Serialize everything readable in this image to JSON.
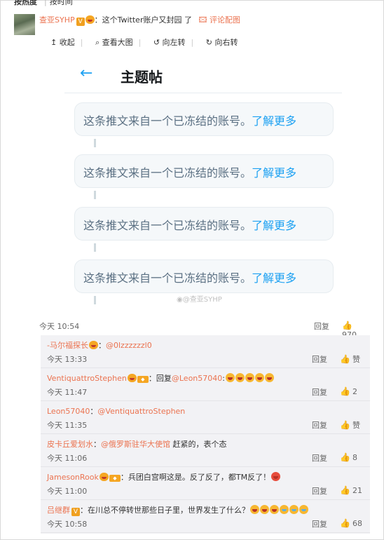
{
  "sort": {
    "hot": "按热度",
    "time": "按时间"
  },
  "main": {
    "username": "查亚SYHP",
    "text": "：这个Twitter账户又封园 了",
    "pic_link": "评论配图",
    "time": "今天 10:54",
    "reply": "回复",
    "likes": "970"
  },
  "image": {
    "toolbar": [
      "收起",
      "查看大图",
      "向左转",
      "向右转"
    ],
    "header_title": "主题帖",
    "box_text": "这条推文来自一个已冻结的账号。",
    "box_link": "了解更多",
    "watermark": "@查亚SYHP"
  },
  "subs": [
    {
      "user": "-马尔福探长",
      "sep": "：",
      "mention": "@0lzzzzzzl0",
      "text": "",
      "time": "今天 13:33",
      "reply": "回复",
      "like": "赞"
    },
    {
      "user": "VentiquattroStephen",
      "sep": "：回复",
      "mention": "@Leon57040",
      "text": ":",
      "time": "今天 11:47",
      "reply": "回复",
      "like": "2"
    },
    {
      "user": "Leon57040",
      "sep": "：",
      "mention": "@VentiquattroStephen",
      "text": "",
      "time": "今天 11:35",
      "reply": "回复",
      "like": "赞"
    },
    {
      "user": "皮卡丘爱划水",
      "sep": "：",
      "mention": "@俄罗斯驻华大使馆",
      "text": " 赶紧的，表个态",
      "time": "今天 11:06",
      "reply": "回复",
      "like": "8"
    },
    {
      "user": "JamesonRook",
      "sep": "：",
      "mention": "",
      "text": "兵团白宫啊这是。反了反了，都TM反了！",
      "time": "今天 11:00",
      "reply": "回复",
      "like": "21"
    },
    {
      "user": "吕继群",
      "sep": "：",
      "mention": "",
      "text": "在川总不停转世那些日子里，世界发生了什么？",
      "time": "今天 10:58",
      "reply": "回复",
      "like": "68"
    }
  ]
}
